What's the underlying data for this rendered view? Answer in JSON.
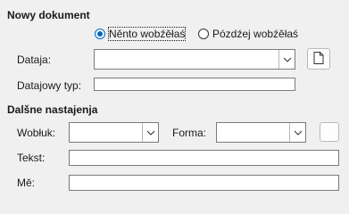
{
  "new_document": {
    "title": "Nowy dokument",
    "radio_now": "Něnto wobźěłaś",
    "radio_later": "Pózdźej wobźěłaś",
    "file_label": "Dataja:",
    "file_value": "",
    "filetype_label": "Datajowy typ:",
    "filetype_value": ""
  },
  "further_settings": {
    "title": "Dalšne nastajenja",
    "style_label": "Wobłuk:",
    "style_value": "",
    "form_label": "Forma:",
    "form_value": "",
    "text_label": "Tekst:",
    "text_value": "",
    "name_label": "Mě:",
    "name_value": ""
  },
  "icons": {
    "browse": "document-icon",
    "dropdown": "chevron-down-icon"
  }
}
